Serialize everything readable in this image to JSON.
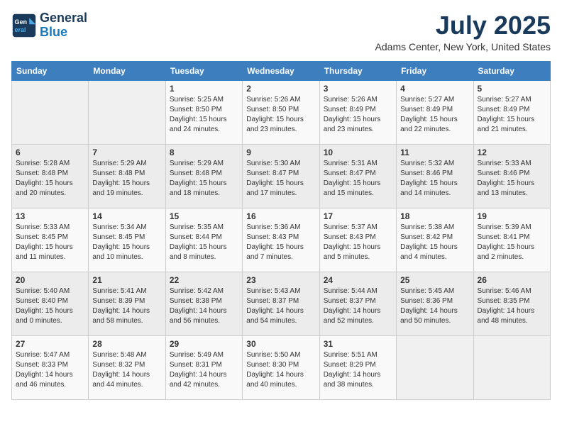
{
  "logo": {
    "line1": "General",
    "line2": "Blue"
  },
  "title": "July 2025",
  "location": "Adams Center, New York, United States",
  "weekdays": [
    "Sunday",
    "Monday",
    "Tuesday",
    "Wednesday",
    "Thursday",
    "Friday",
    "Saturday"
  ],
  "weeks": [
    [
      {
        "day": "",
        "info": ""
      },
      {
        "day": "",
        "info": ""
      },
      {
        "day": "1",
        "info": "Sunrise: 5:25 AM\nSunset: 8:50 PM\nDaylight: 15 hours and 24 minutes."
      },
      {
        "day": "2",
        "info": "Sunrise: 5:26 AM\nSunset: 8:50 PM\nDaylight: 15 hours and 23 minutes."
      },
      {
        "day": "3",
        "info": "Sunrise: 5:26 AM\nSunset: 8:49 PM\nDaylight: 15 hours and 23 minutes."
      },
      {
        "day": "4",
        "info": "Sunrise: 5:27 AM\nSunset: 8:49 PM\nDaylight: 15 hours and 22 minutes."
      },
      {
        "day": "5",
        "info": "Sunrise: 5:27 AM\nSunset: 8:49 PM\nDaylight: 15 hours and 21 minutes."
      }
    ],
    [
      {
        "day": "6",
        "info": "Sunrise: 5:28 AM\nSunset: 8:48 PM\nDaylight: 15 hours and 20 minutes."
      },
      {
        "day": "7",
        "info": "Sunrise: 5:29 AM\nSunset: 8:48 PM\nDaylight: 15 hours and 19 minutes."
      },
      {
        "day": "8",
        "info": "Sunrise: 5:29 AM\nSunset: 8:48 PM\nDaylight: 15 hours and 18 minutes."
      },
      {
        "day": "9",
        "info": "Sunrise: 5:30 AM\nSunset: 8:47 PM\nDaylight: 15 hours and 17 minutes."
      },
      {
        "day": "10",
        "info": "Sunrise: 5:31 AM\nSunset: 8:47 PM\nDaylight: 15 hours and 15 minutes."
      },
      {
        "day": "11",
        "info": "Sunrise: 5:32 AM\nSunset: 8:46 PM\nDaylight: 15 hours and 14 minutes."
      },
      {
        "day": "12",
        "info": "Sunrise: 5:33 AM\nSunset: 8:46 PM\nDaylight: 15 hours and 13 minutes."
      }
    ],
    [
      {
        "day": "13",
        "info": "Sunrise: 5:33 AM\nSunset: 8:45 PM\nDaylight: 15 hours and 11 minutes."
      },
      {
        "day": "14",
        "info": "Sunrise: 5:34 AM\nSunset: 8:45 PM\nDaylight: 15 hours and 10 minutes."
      },
      {
        "day": "15",
        "info": "Sunrise: 5:35 AM\nSunset: 8:44 PM\nDaylight: 15 hours and 8 minutes."
      },
      {
        "day": "16",
        "info": "Sunrise: 5:36 AM\nSunset: 8:43 PM\nDaylight: 15 hours and 7 minutes."
      },
      {
        "day": "17",
        "info": "Sunrise: 5:37 AM\nSunset: 8:43 PM\nDaylight: 15 hours and 5 minutes."
      },
      {
        "day": "18",
        "info": "Sunrise: 5:38 AM\nSunset: 8:42 PM\nDaylight: 15 hours and 4 minutes."
      },
      {
        "day": "19",
        "info": "Sunrise: 5:39 AM\nSunset: 8:41 PM\nDaylight: 15 hours and 2 minutes."
      }
    ],
    [
      {
        "day": "20",
        "info": "Sunrise: 5:40 AM\nSunset: 8:40 PM\nDaylight: 15 hours and 0 minutes."
      },
      {
        "day": "21",
        "info": "Sunrise: 5:41 AM\nSunset: 8:39 PM\nDaylight: 14 hours and 58 minutes."
      },
      {
        "day": "22",
        "info": "Sunrise: 5:42 AM\nSunset: 8:38 PM\nDaylight: 14 hours and 56 minutes."
      },
      {
        "day": "23",
        "info": "Sunrise: 5:43 AM\nSunset: 8:37 PM\nDaylight: 14 hours and 54 minutes."
      },
      {
        "day": "24",
        "info": "Sunrise: 5:44 AM\nSunset: 8:37 PM\nDaylight: 14 hours and 52 minutes."
      },
      {
        "day": "25",
        "info": "Sunrise: 5:45 AM\nSunset: 8:36 PM\nDaylight: 14 hours and 50 minutes."
      },
      {
        "day": "26",
        "info": "Sunrise: 5:46 AM\nSunset: 8:35 PM\nDaylight: 14 hours and 48 minutes."
      }
    ],
    [
      {
        "day": "27",
        "info": "Sunrise: 5:47 AM\nSunset: 8:33 PM\nDaylight: 14 hours and 46 minutes."
      },
      {
        "day": "28",
        "info": "Sunrise: 5:48 AM\nSunset: 8:32 PM\nDaylight: 14 hours and 44 minutes."
      },
      {
        "day": "29",
        "info": "Sunrise: 5:49 AM\nSunset: 8:31 PM\nDaylight: 14 hours and 42 minutes."
      },
      {
        "day": "30",
        "info": "Sunrise: 5:50 AM\nSunset: 8:30 PM\nDaylight: 14 hours and 40 minutes."
      },
      {
        "day": "31",
        "info": "Sunrise: 5:51 AM\nSunset: 8:29 PM\nDaylight: 14 hours and 38 minutes."
      },
      {
        "day": "",
        "info": ""
      },
      {
        "day": "",
        "info": ""
      }
    ]
  ]
}
